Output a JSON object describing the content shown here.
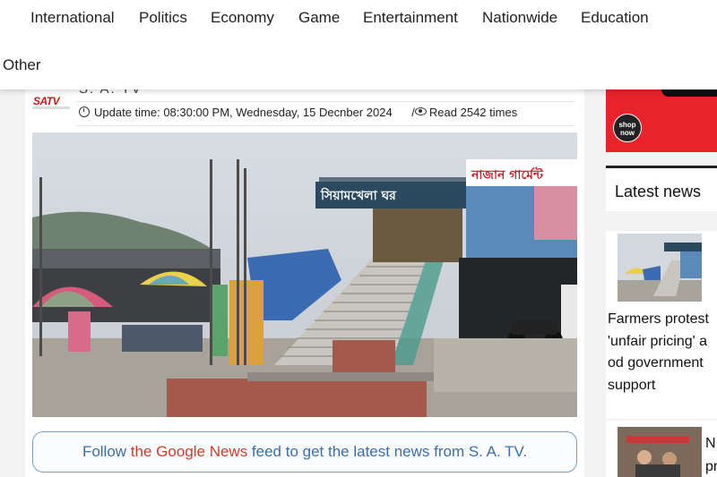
{
  "nav": {
    "items": [
      "International",
      "Politics",
      "Economy",
      "Game",
      "Entertainment",
      "Nationwide",
      "Education"
    ],
    "row2": "Other"
  },
  "article": {
    "logo_text": "SATV",
    "channel": "S. A. TV",
    "update_time": "Update time: 08:30:00 PM, Wednesday, 15 Decnber 2024",
    "reads": "Read 2542 times",
    "photo_sign_left": "সিয়ামখেলা ঘর",
    "photo_sign_right": "নাজান গার্মেন্ট",
    "follow": {
      "part1": "Follow ",
      "part2": "the Google News",
      "part3": " feed to get the latest news from S. A. TV."
    }
  },
  "sidebar": {
    "ad_button": "shop now",
    "latest_title": "Latest news",
    "news1_lines": [
      "Farmers protest",
      "'unfair pricing' a",
      "od government",
      "support"
    ],
    "news2_lines": [
      "N",
      "pr"
    ]
  },
  "colors": {
    "accent_red": "#e8232b",
    "follow_blue": "#3a6ea8",
    "google_red": "#d23c2c"
  }
}
